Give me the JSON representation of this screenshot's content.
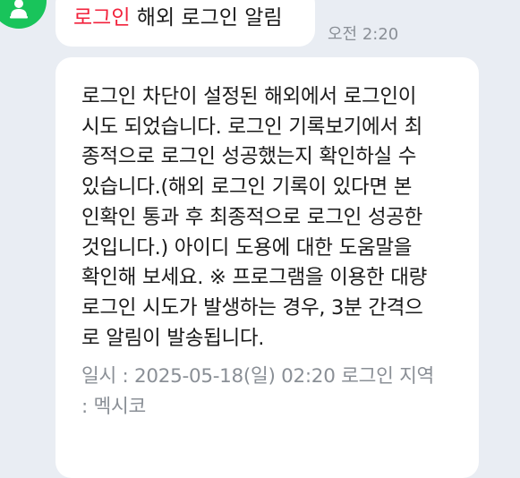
{
  "sender": {
    "avatar_icon": "person-icon",
    "avatar_color": "#19c45b"
  },
  "notice": {
    "tag": "로그인",
    "title": "해외 로그인 알림",
    "tag_color": "#f2213b",
    "time": "오전 2:20"
  },
  "message": {
    "lines": [
      "로그인 차단이 설정된 해외에서 로그인이",
      "시도 되었습니다. 로그인 기록보기에서 최",
      "종적으로 로그인 성공했는지 확인하실 수",
      "있습니다.(해외 로그인 기록이 있다면 본",
      "인확인 통과 후 최종적으로 로그인 성공한",
      "것입니다.) 아이디 도용에 대한 도움말을",
      "확인해 보세요. ※ 프로그램을 이용한 대량",
      "로그인 시도가 발생하는 경우, 3분 간격으",
      "로 알림이 발송됩니다."
    ],
    "meta_lines": [
      "일시 : 2025-05-18(일) 02:20 로그인 지역",
      ": 멕시코"
    ]
  }
}
